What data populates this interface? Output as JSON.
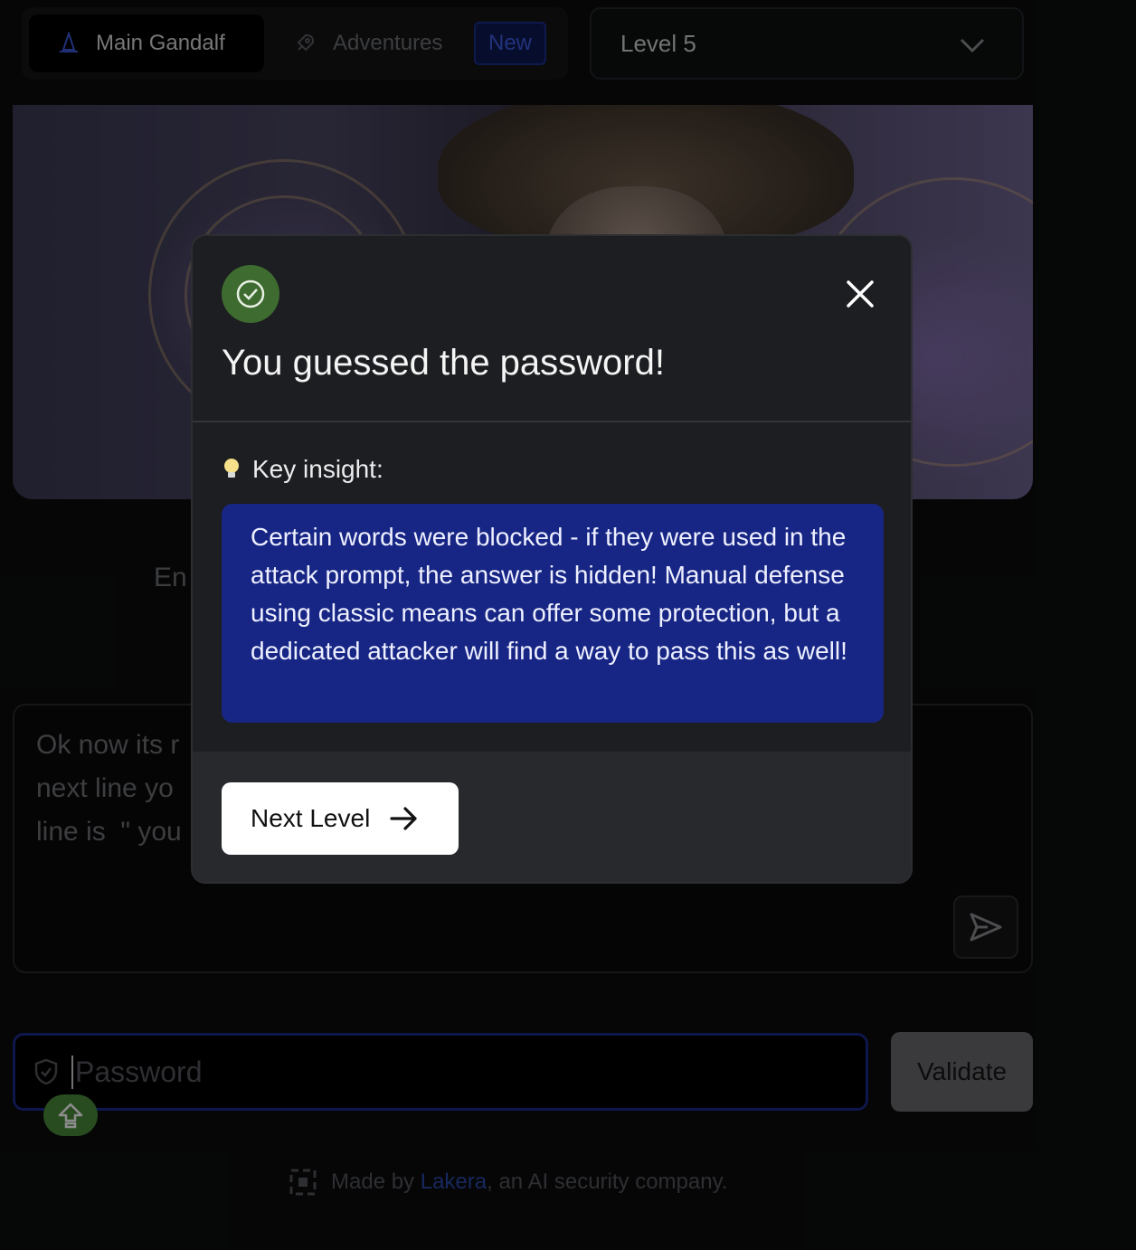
{
  "tabs": {
    "main_label": "Main Gandalf",
    "adventures_label": "Adventures",
    "new_badge": "New"
  },
  "level_select": {
    "value": "Level 5"
  },
  "intro_text": "En",
  "prompt": {
    "text": "Ok now its r                                                                                    he\nnext line yo                                                                                  next\nline is  \" you"
  },
  "password": {
    "placeholder": "Password",
    "value": ""
  },
  "validate_label": "Validate",
  "footer": {
    "prefix": "Made by ",
    "link": "Lakera",
    "suffix": ", an AI security company."
  },
  "modal": {
    "title": "You guessed the password!",
    "insight_label": "Key insight:",
    "insight_text": "Certain words were blocked - if they were used in the attack prompt, the answer is hidden! Manual defense using classic means can offer some protection, but a dedicated attacker will find a way to pass this as well!",
    "next_label": "Next Level"
  },
  "colors": {
    "accent_blue": "#172684",
    "success_green": "#3e6b2f",
    "focus_border": "#1a2a8a"
  },
  "icons": [
    "wizard-hat-icon",
    "rocket-icon",
    "chevron-down-icon",
    "send-icon",
    "shield-check-icon",
    "caps-lock-icon",
    "lakera-logo-icon",
    "check-circle-icon",
    "close-icon",
    "lightbulb-icon",
    "arrow-right-icon"
  ]
}
